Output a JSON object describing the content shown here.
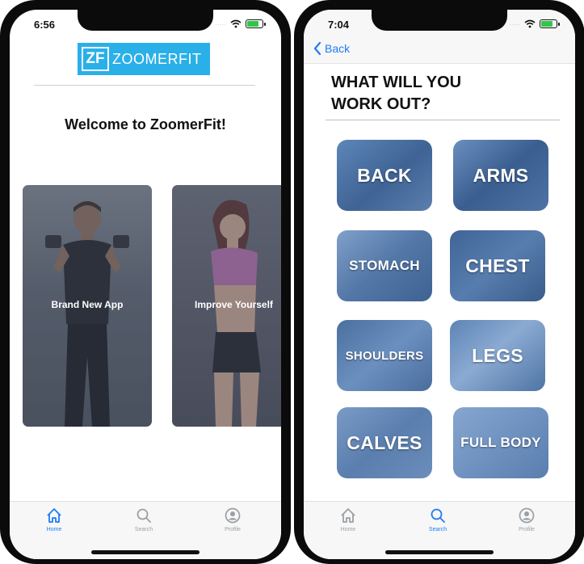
{
  "home_screen": {
    "status": {
      "time": "6:56",
      "signal": "....."
    },
    "logo": {
      "mark": "ZF",
      "text": "ZOOMERFIT"
    },
    "welcome": "Welcome to ZoomerFit!",
    "cards": [
      {
        "label": "Brand New App"
      },
      {
        "label": "Improve Yourself"
      }
    ],
    "tabs": [
      {
        "label": "Home",
        "icon": "home-icon",
        "active": true
      },
      {
        "label": "Search",
        "icon": "search-icon",
        "active": false
      },
      {
        "label": "Profile",
        "icon": "profile-icon",
        "active": false
      }
    ]
  },
  "workout_screen": {
    "status": {
      "time": "7:04",
      "signal": "....."
    },
    "back_label": "Back",
    "title_line1": "WHAT WILL YOU",
    "title_line2": "WORK OUT?",
    "categories": [
      {
        "label": "BACK"
      },
      {
        "label": "ARMS"
      },
      {
        "label": "STOMACH"
      },
      {
        "label": "CHEST"
      },
      {
        "label": "SHOULDERS"
      },
      {
        "label": "LEGS"
      },
      {
        "label": "CALVES"
      },
      {
        "label": "FULL BODY"
      }
    ],
    "tabs": [
      {
        "label": "Home",
        "icon": "home-icon",
        "active": false
      },
      {
        "label": "Search",
        "icon": "search-icon",
        "active": true
      },
      {
        "label": "Profile",
        "icon": "profile-icon",
        "active": false
      }
    ]
  },
  "colors": {
    "accent": "#1e7cf2",
    "logo_bg": "#2ab0e8",
    "tile_tint": "#4a74a8",
    "battery": "#2ec74a",
    "tab_inactive": "#9aa0a6"
  }
}
